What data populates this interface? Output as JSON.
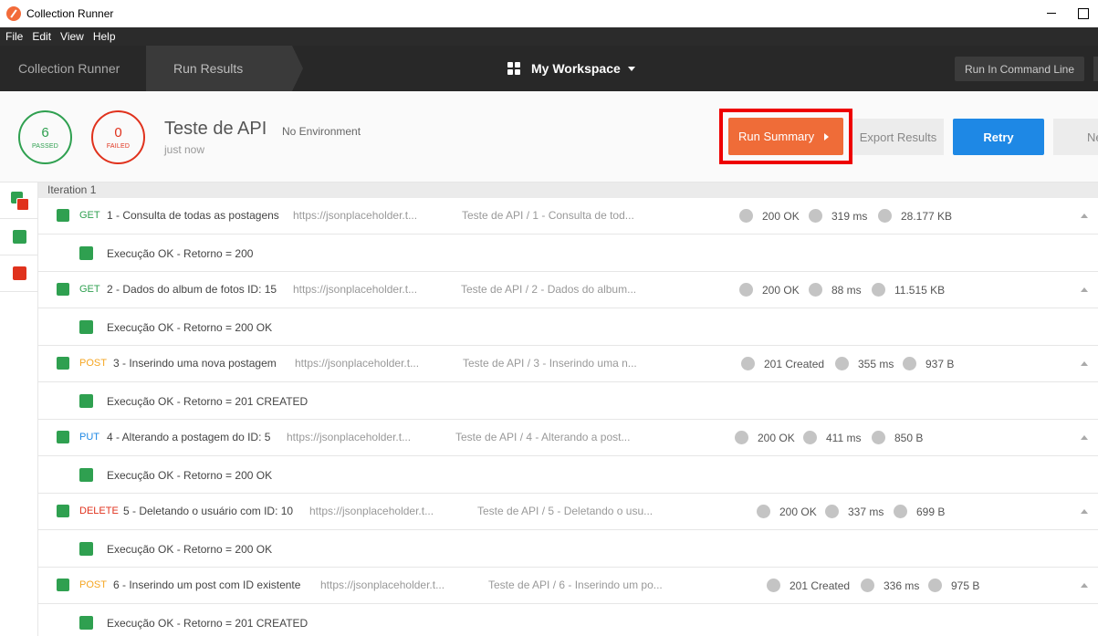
{
  "window": {
    "title": "Collection Runner"
  },
  "menu": [
    "File",
    "Edit",
    "View",
    "Help"
  ],
  "header": {
    "crumbs": [
      "Collection Runner",
      "Run Results"
    ],
    "workspace": "My Workspace",
    "command_line": "Run In Command Line"
  },
  "summary": {
    "passed": {
      "count": "6",
      "label": "PASSED"
    },
    "failed": {
      "count": "0",
      "label": "FAILED"
    },
    "name": "Teste de API",
    "environment": "No Environment",
    "time": "just now",
    "buttons": {
      "run_summary": "Run Summary",
      "export": "Export Results",
      "retry": "Retry",
      "new": "Ne"
    }
  },
  "colors": {
    "pass": "#2fa050",
    "fail": "#e0321d",
    "accent": "#ef6c38",
    "primary": "#1e88e5",
    "highlight": "#ee0000"
  },
  "iteration": {
    "label": "Iteration 1"
  },
  "requests": [
    {
      "method": "GET",
      "name": "1 - Consulta de todas as postagens",
      "url": "https://jsonplaceholder.t...",
      "path": "Teste de API / 1 - Consulta de tod...",
      "status": "200 OK",
      "time": "319 ms",
      "size": "28.177 KB",
      "test": "Execução OK - Retorno = 200"
    },
    {
      "method": "GET",
      "name": "2 - Dados do album de fotos ID: 15",
      "url": "https://jsonplaceholder.t...",
      "path": "Teste de API / 2 - Dados do album...",
      "status": "200 OK",
      "time": "88 ms",
      "size": "11.515 KB",
      "test": "Execução OK - Retorno = 200 OK"
    },
    {
      "method": "POST",
      "name": "3 - Inserindo uma nova postagem",
      "url": "https://jsonplaceholder.t...",
      "path": "Teste de API / 3 - Inserindo uma n...",
      "status": "201 Created",
      "time": "355 ms",
      "size": "937 B",
      "test": "Execução OK - Retorno = 201 CREATED"
    },
    {
      "method": "PUT",
      "name": "4 - Alterando a postagem do ID: 5",
      "url": "https://jsonplaceholder.t...",
      "path": "Teste de API / 4 - Alterando a post...",
      "status": "200 OK",
      "time": "411 ms",
      "size": "850 B",
      "test": "Execução OK - Retorno = 200 OK"
    },
    {
      "method": "DELETE",
      "name": "5 - Deletando o usuário com ID: 10",
      "url": "https://jsonplaceholder.t...",
      "path": "Teste de API / 5 - Deletando o usu...",
      "status": "200 OK",
      "time": "337 ms",
      "size": "699 B",
      "test": "Execução OK - Retorno = 200 OK"
    },
    {
      "method": "POST",
      "name": "6 - Inserindo um post com ID existente",
      "url": "https://jsonplaceholder.t...",
      "path": "Teste de API / 6 - Inserindo um po...",
      "status": "201 Created",
      "time": "336 ms",
      "size": "975 B",
      "test": "Execução OK - Retorno = 201 CREATED"
    }
  ]
}
